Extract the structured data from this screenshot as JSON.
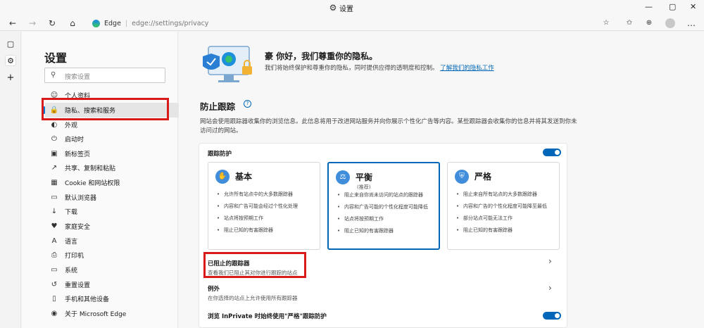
{
  "window": {
    "title": "设置",
    "settings_icon": "gear-icon",
    "minimize": "—",
    "maximize": "▢",
    "close": "✕"
  },
  "toolbar": {
    "back": "←",
    "forward": "→",
    "refresh": "↻",
    "home": "⌂",
    "site_label": "Edge",
    "url": "edge://settings/privacy",
    "icons": [
      "favorites-add-icon",
      "favorites-icon",
      "collections-icon",
      "profile-icon",
      "more-icon"
    ]
  },
  "rail": {
    "icons": [
      "tab-actions-icon",
      "settings-icon",
      "add-icon"
    ]
  },
  "sidebar": {
    "title": "设置",
    "search_placeholder": "搜索设置",
    "items": [
      {
        "label": "个人资料",
        "icon": "profile-icon",
        "glyph": "☺"
      },
      {
        "label": "隐私、搜索和服务",
        "icon": "lock-icon",
        "glyph": "🔒"
      },
      {
        "label": "外观",
        "icon": "appearance-icon",
        "glyph": "◐"
      },
      {
        "label": "启动时",
        "icon": "power-icon",
        "glyph": "⏻"
      },
      {
        "label": "新标签页",
        "icon": "new-tab-icon",
        "glyph": "▣"
      },
      {
        "label": "共享、复制和粘贴",
        "icon": "share-icon",
        "glyph": "↗"
      },
      {
        "label": "Cookie 和网站权限",
        "icon": "cookie-icon",
        "glyph": "▦"
      },
      {
        "label": "默认浏览器",
        "icon": "browser-icon",
        "glyph": "▭"
      },
      {
        "label": "下载",
        "icon": "download-icon",
        "glyph": "↓"
      },
      {
        "label": "家庭安全",
        "icon": "family-icon",
        "glyph": "♥"
      },
      {
        "label": "语言",
        "icon": "language-icon",
        "glyph": "A"
      },
      {
        "label": "打印机",
        "icon": "printer-icon",
        "glyph": "⎙"
      },
      {
        "label": "系统",
        "icon": "system-icon",
        "glyph": "▭"
      },
      {
        "label": "重置设置",
        "icon": "reset-icon",
        "glyph": "↺"
      },
      {
        "label": "手机和其他设备",
        "icon": "phone-icon",
        "glyph": "▯"
      },
      {
        "label": "关于 Microsoft Edge",
        "icon": "edge-icon",
        "glyph": "◉"
      }
    ]
  },
  "hero": {
    "title": "豪 你好，我们尊重你的隐私。",
    "desc": "我们将始终保护和尊重你的隐私，同时提供应得的透明度和控制。",
    "link": "了解我们的隐私工作"
  },
  "tracking": {
    "title": "防止跟踪",
    "help": "?",
    "desc": "网站会使用跟踪器收集你的浏览信息。此信息将用于改进网站服务并向你展示个性化广告等内容。某些跟踪器会收集你的信息并将其发送到你未访问过的网站。",
    "toggle_label": "跟踪防护",
    "toggle_on": true,
    "options": [
      {
        "name": "基本",
        "subtitle": "",
        "icon": "hand-icon",
        "glyph": "✋",
        "selected": false,
        "bullets": [
          "允许所有站点中的大多数跟踪器",
          "内容和广告可能会经过个性化处理",
          "站点将按预期工作",
          "阻止已知的有害跟踪器"
        ]
      },
      {
        "name": "平衡",
        "subtitle": "(推荐)",
        "icon": "scale-icon",
        "glyph": "⚖",
        "selected": true,
        "bullets": [
          "阻止来自你尚未访问的站点的跟踪器",
          "内容和广告可能的个性化程度可能降低",
          "站点将按预期工作",
          "阻止已知的有害跟踪器"
        ]
      },
      {
        "name": "严格",
        "subtitle": "",
        "icon": "shield-icon",
        "glyph": "⛨",
        "selected": false,
        "bullets": [
          "阻止来自所有站点的大多数跟踪器",
          "内容和广告的个性化程度可能降至最低",
          "部分站点可能无法工作",
          "阻止已知的有害跟踪器"
        ]
      }
    ],
    "blocked": {
      "label": "已阻止的跟踪器",
      "desc": "查看我们已阻止其对你进行跟踪的站点"
    },
    "exceptions": {
      "label": "例外",
      "desc": "在你选择的站点上允许使用所有跟踪器"
    },
    "inprivate": {
      "label": "浏览 InPrivate 时始终使用\"严格\"跟踪防护",
      "toggle_on": true
    }
  },
  "colors": {
    "accent": "#0067b8",
    "highlight_box": "#d91a1a"
  }
}
